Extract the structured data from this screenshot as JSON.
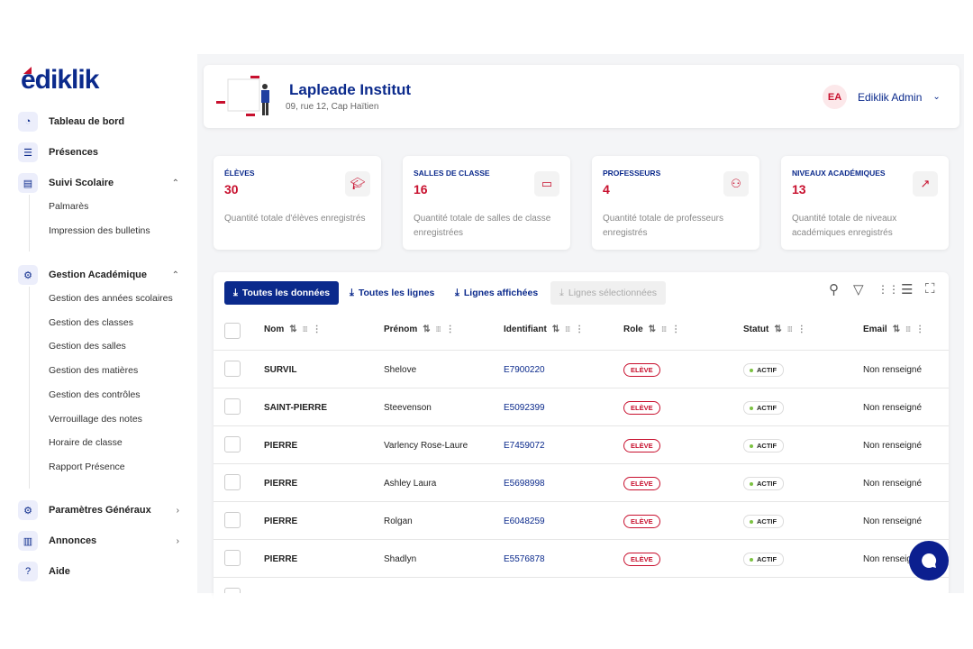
{
  "brand": {
    "logo": "ediklik",
    "navy": "#0b2a8c",
    "red": "#c8102e"
  },
  "sidebar": {
    "items": [
      {
        "label": "Tableau de bord",
        "icon": "dashboard-icon"
      },
      {
        "label": "Présences",
        "icon": "checklist-icon"
      },
      {
        "label": "Suivi Scolaire",
        "icon": "document-icon",
        "expanded": true,
        "children": [
          "Palmarès",
          "Impression des bulletins"
        ]
      },
      {
        "label": "Gestion Académique",
        "icon": "gear-icon",
        "expanded": true,
        "children": [
          "Gestion des années scolaires",
          "Gestion des classes",
          "Gestion des salles",
          "Gestion des matières",
          "Gestion des contrôles",
          "Verrouillage des notes",
          "Horaire de classe",
          "Rapport Présence"
        ]
      },
      {
        "label": "Paramètres Généraux",
        "icon": "gear-icon"
      },
      {
        "label": "Annonces",
        "icon": "newspaper-icon"
      },
      {
        "label": "Aide",
        "icon": "help-icon"
      }
    ]
  },
  "header": {
    "title": "Lapleade Institut",
    "address": "09, rue 12, Cap Haïtien",
    "user_initials": "EA",
    "user_name": "Ediklik Admin"
  },
  "stats": [
    {
      "label": "ÉLÈVES",
      "value": "30",
      "desc": "Quantité totale d'élèves enregistrés",
      "icon": "graduation-cap-icon"
    },
    {
      "label": "SALLES DE CLASSE",
      "value": "16",
      "desc": "Quantité totale de salles de classe enregistrées",
      "icon": "screen-icon"
    },
    {
      "label": "PROFESSEURS",
      "value": "4",
      "desc": "Quantité totale de professeurs enregistrés",
      "icon": "users-icon"
    },
    {
      "label": "NIVEAUX ACADÉMIQUES",
      "value": "13",
      "desc": "Quantité totale de niveaux académiques enregistrés",
      "icon": "trending-up-icon"
    }
  ],
  "toolbar": {
    "export_all": "Toutes les données",
    "export_rows": "Toutes les lignes",
    "export_shown": "Lignes affichées",
    "export_selected": "Lignes sélectionnées"
  },
  "table": {
    "columns": [
      "Nom",
      "Prénom",
      "Identifiant",
      "Role",
      "Statut",
      "Email"
    ],
    "rows": [
      [
        "SURVIL",
        "Shelove",
        "E7900220",
        "ELÈVE",
        "ACTIF",
        "Non renseigné"
      ],
      [
        "SAINT-PIERRE",
        "Steevenson",
        "E5092399",
        "ELÈVE",
        "ACTIF",
        "Non renseigné"
      ],
      [
        "PIERRE",
        "Varlency Rose-Laure",
        "E7459072",
        "ELÈVE",
        "ACTIF",
        "Non renseigné"
      ],
      [
        "PIERRE",
        "Ashley Laura",
        "E5698998",
        "ELÈVE",
        "ACTIF",
        "Non renseigné"
      ],
      [
        "PIERRE",
        "Rolgan",
        "E6048259",
        "ELÈVE",
        "ACTIF",
        "Non renseigné"
      ],
      [
        "PIERRE",
        "Shadlyn",
        "E5576878",
        "ELÈVE",
        "ACTIF",
        "Non renseigné"
      ]
    ]
  }
}
